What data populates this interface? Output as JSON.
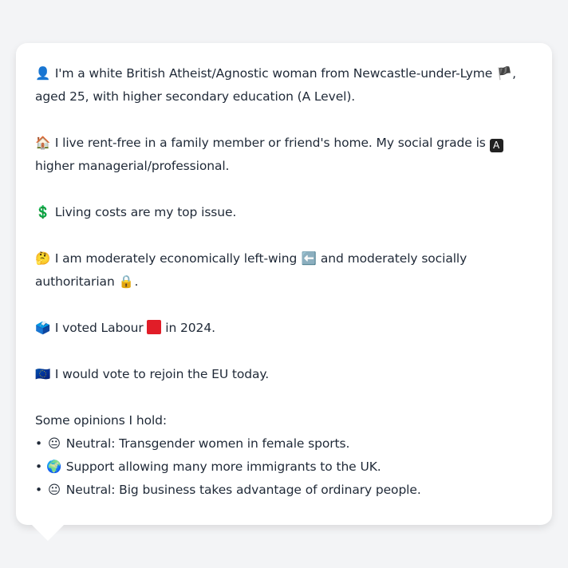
{
  "profile": {
    "identity": {
      "icon": "👤",
      "text1": "I'm a white British Atheist/Agnostic woman from Newcastle-under-Lyme",
      "flag": "🏴",
      "text2": ", aged 25, with higher secondary education (A Level)."
    },
    "housing": {
      "icon": "🏠",
      "text1": "I live rent-free in a family member or friend's home. My social grade is",
      "grade": "A",
      "text2": "higher managerial/professional."
    },
    "issue": {
      "icon": "💲",
      "text": "Living costs are my top issue."
    },
    "ideology": {
      "icon": "🤔",
      "text1": "I am moderately economically left-wing",
      "left_icon": "⬅️",
      "text2": "and moderately socially authoritarian",
      "lock_icon": "🔒",
      "text3": "."
    },
    "vote": {
      "icon": "🗳️",
      "text1": "I voted Labour",
      "party_color": "#e11d28",
      "text2": "in 2024."
    },
    "eu": {
      "icon": "🇪🇺",
      "text": "I would vote to rejoin the EU today."
    },
    "opinions_heading": "Some opinions I hold:",
    "opinions": [
      {
        "bullet": "•",
        "icon": "😐",
        "text": "Neutral: Transgender women in female sports."
      },
      {
        "bullet": "•",
        "icon": "🌍",
        "text": "Support allowing many more immigrants to the UK."
      },
      {
        "bullet": "•",
        "icon": "😐",
        "text": "Neutral: Big business takes advantage of ordinary people."
      }
    ]
  }
}
